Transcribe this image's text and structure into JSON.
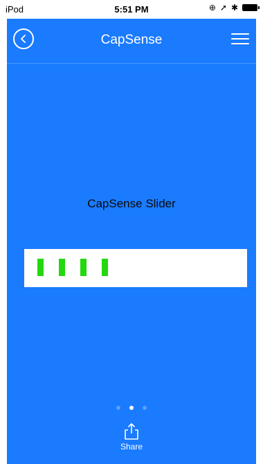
{
  "status_bar": {
    "device": "iPod",
    "time": "5:51 PM"
  },
  "nav": {
    "title": "CapSense",
    "back_icon": "back-chevron-circle-icon",
    "menu_icon": "hamburger-menu-icon"
  },
  "slider": {
    "label": "CapSense Slider",
    "active_segments": 4,
    "segment_color": "#23d80f"
  },
  "pager": {
    "total": 3,
    "current": 2
  },
  "share": {
    "label": "Share",
    "icon": "share-icon"
  },
  "colors": {
    "background": "#1a7bff",
    "nav_text": "#ffffff",
    "slider_track": "#ffffff"
  }
}
